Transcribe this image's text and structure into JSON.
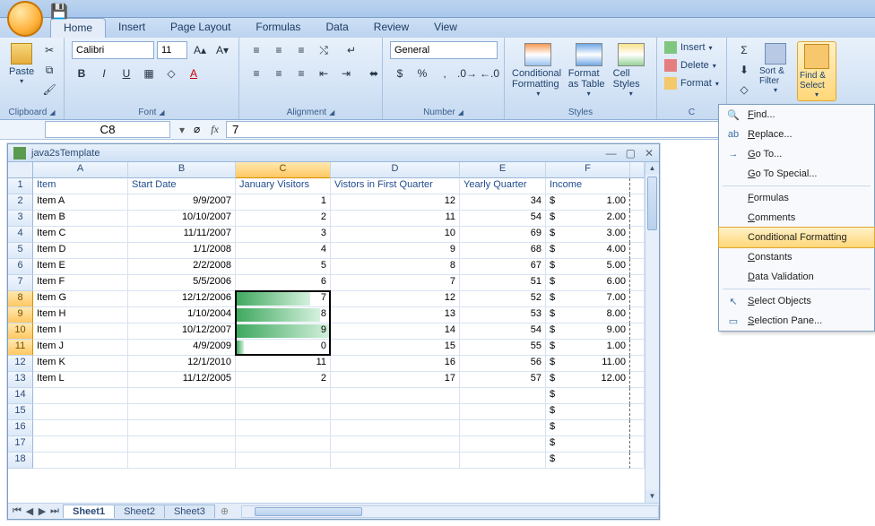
{
  "tabs": [
    "Home",
    "Insert",
    "Page Layout",
    "Formulas",
    "Data",
    "Review",
    "View"
  ],
  "active_tab": "Home",
  "ribbon": {
    "clipboard": {
      "title": "Clipboard",
      "paste": "Paste"
    },
    "font": {
      "title": "Font",
      "family": "Calibri",
      "size": "11"
    },
    "alignment": {
      "title": "Alignment"
    },
    "number": {
      "title": "Number",
      "format": "General"
    },
    "styles": {
      "title": "Styles",
      "cond": "Conditional Formatting",
      "table": "Format as Table",
      "cell": "Cell Styles"
    },
    "cells": {
      "title": "C",
      "insert": "Insert",
      "delete": "Delete",
      "format": "Format"
    },
    "editing": {
      "sort": "Sort & Filter",
      "find": "Find & Select"
    }
  },
  "formula_bar": {
    "name_box": "C8",
    "formula": "7"
  },
  "workbook": {
    "title": "java2sTemplate",
    "sheets": [
      "Sheet1",
      "Sheet2",
      "Sheet3"
    ],
    "active_sheet": "Sheet1",
    "columns": [
      "A",
      "B",
      "C",
      "D",
      "E",
      "F"
    ],
    "header_row": [
      "Item",
      "Start Date",
      "January Visitors",
      "Vistors in First Quarter",
      "Yearly Quarter",
      "Income"
    ],
    "rows": [
      {
        "item": "Item A",
        "date": "9/9/2007",
        "jan": 1,
        "fq": 12,
        "yq": 34,
        "inc": "1.00"
      },
      {
        "item": "Item B",
        "date": "10/10/2007",
        "jan": 2,
        "fq": 11,
        "yq": 54,
        "inc": "2.00"
      },
      {
        "item": "Item C",
        "date": "11/11/2007",
        "jan": 3,
        "fq": 10,
        "yq": 69,
        "inc": "3.00"
      },
      {
        "item": "Item D",
        "date": "1/1/2008",
        "jan": 4,
        "fq": 9,
        "yq": 68,
        "inc": "4.00"
      },
      {
        "item": "Item E",
        "date": "2/2/2008",
        "jan": 5,
        "fq": 8,
        "yq": 67,
        "inc": "5.00"
      },
      {
        "item": "Item F",
        "date": "5/5/2006",
        "jan": 6,
        "fq": 7,
        "yq": 51,
        "inc": "6.00"
      },
      {
        "item": "Item G",
        "date": "12/12/2006",
        "jan": 7,
        "fq": 12,
        "yq": 52,
        "inc": "7.00",
        "bar": 78
      },
      {
        "item": "Item H",
        "date": "1/10/2004",
        "jan": 8,
        "fq": 13,
        "yq": 53,
        "inc": "8.00",
        "bar": 89
      },
      {
        "item": "Item I",
        "date": "10/12/2007",
        "jan": 9,
        "fq": 14,
        "yq": 54,
        "inc": "9.00",
        "bar": 100
      },
      {
        "item": "Item J",
        "date": "4/9/2009",
        "jan": 0,
        "fq": 15,
        "yq": 55,
        "inc": "1.00",
        "bar": 8
      },
      {
        "item": "Item K",
        "date": "12/1/2010",
        "jan": 11,
        "fq": 16,
        "yq": 56,
        "inc": "11.00"
      },
      {
        "item": "Item L",
        "date": "11/12/2005",
        "jan": 2,
        "fq": 17,
        "yq": 57,
        "inc": "12.00"
      }
    ],
    "selected_col": 2,
    "selection": {
      "top_row": 8,
      "bottom_row": 11
    }
  },
  "menu": {
    "items": [
      {
        "icon": "🔍",
        "label": "Find..."
      },
      {
        "icon": "ab",
        "label": "Replace..."
      },
      {
        "icon": "→",
        "label": "Go To..."
      },
      {
        "icon": "",
        "label": "Go To Special..."
      },
      {
        "sep": true
      },
      {
        "icon": "",
        "label": "Formulas"
      },
      {
        "icon": "",
        "label": "Comments"
      },
      {
        "icon": "",
        "label": "Conditional Formatting",
        "hl": true
      },
      {
        "icon": "",
        "label": "Constants"
      },
      {
        "icon": "",
        "label": "Data Validation"
      },
      {
        "sep": true
      },
      {
        "icon": "↖",
        "label": "Select Objects"
      },
      {
        "icon": "▭",
        "label": "Selection Pane..."
      }
    ]
  }
}
